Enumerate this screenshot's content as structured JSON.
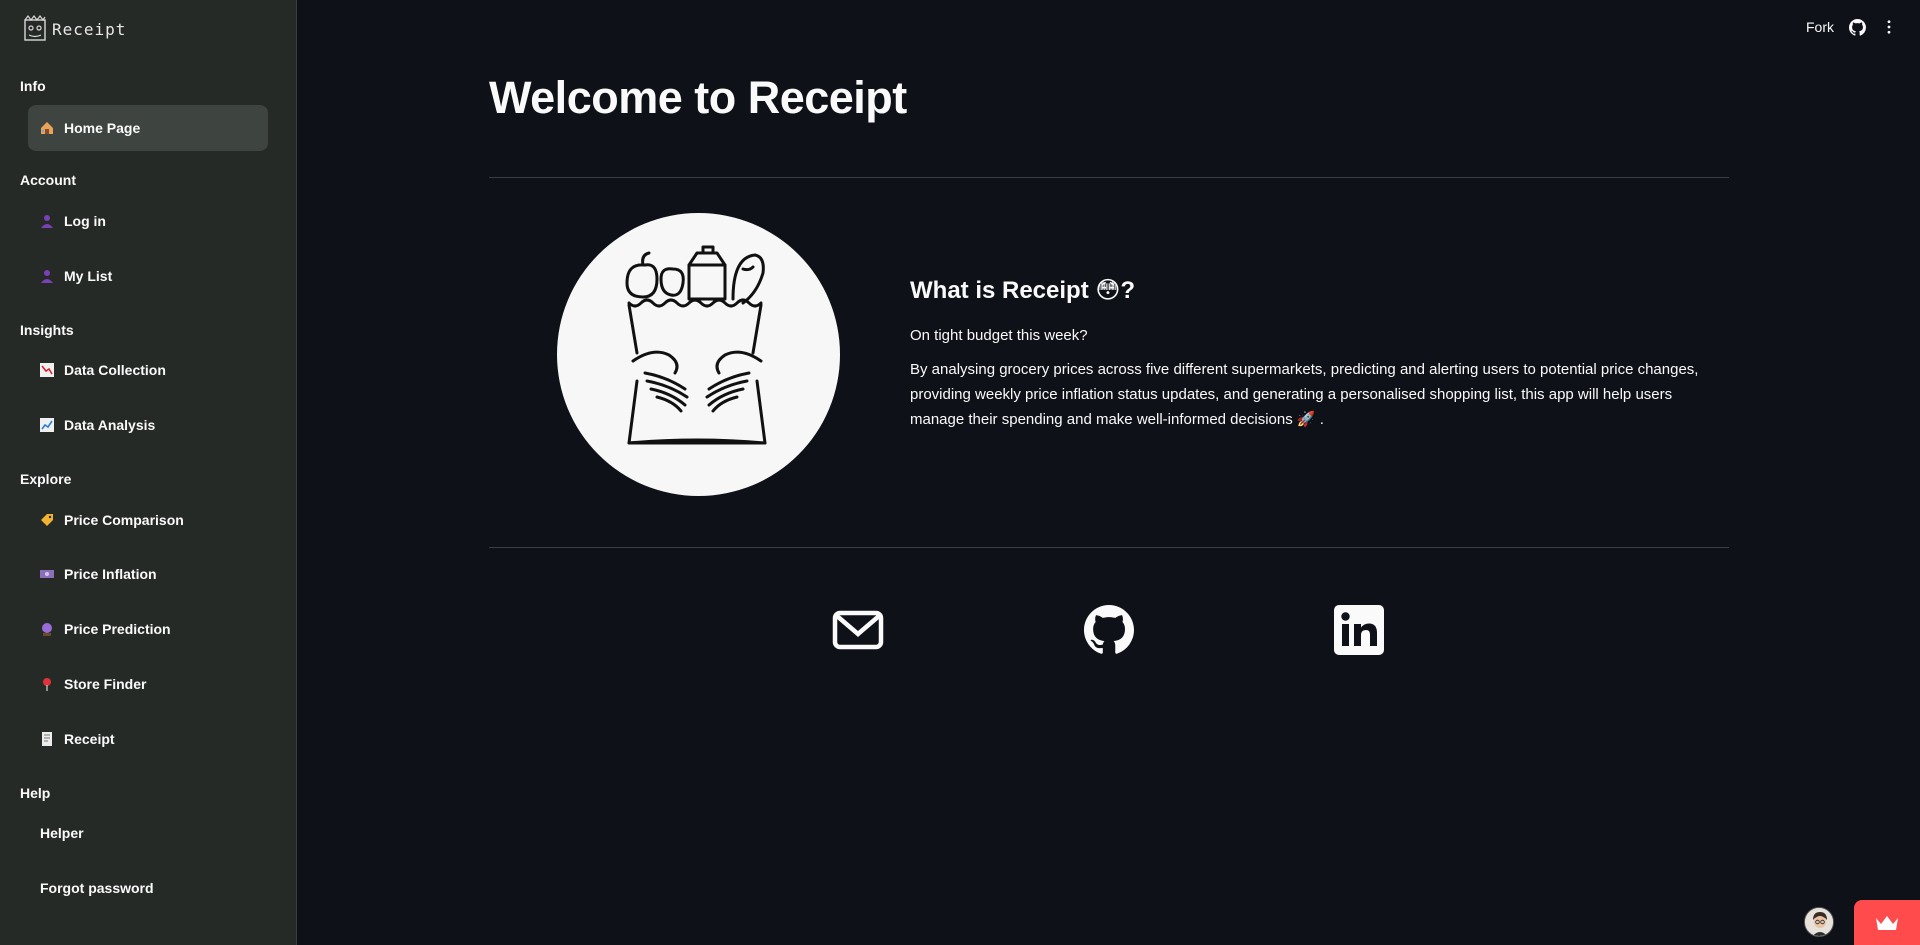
{
  "brand": {
    "name": "Receipt"
  },
  "sidebar": {
    "sections": [
      {
        "title": "Info",
        "items": [
          {
            "label": "Home Page",
            "icon": "house-icon"
          }
        ]
      },
      {
        "title": "Account",
        "items": [
          {
            "label": "Log in",
            "icon": "person-icon"
          },
          {
            "label": "My List",
            "icon": "person-icon"
          }
        ]
      },
      {
        "title": "Insights",
        "items": [
          {
            "label": "Data Collection",
            "icon": "chart-decreasing-icon"
          },
          {
            "label": "Data Analysis",
            "icon": "chart-increasing-icon"
          }
        ]
      },
      {
        "title": "Explore",
        "items": [
          {
            "label": "Price Comparison",
            "icon": "label-tag-icon"
          },
          {
            "label": "Price Inflation",
            "icon": "money-icon"
          },
          {
            "label": "Price Prediction",
            "icon": "crystal-ball-icon"
          },
          {
            "label": "Store Finder",
            "icon": "pin-icon"
          },
          {
            "label": "Receipt",
            "icon": "receipt-icon"
          }
        ]
      },
      {
        "title": "Help",
        "items": [
          {
            "label": "Helper"
          },
          {
            "label": "Forgot password"
          }
        ]
      }
    ]
  },
  "topbar": {
    "fork_label": "Fork"
  },
  "main": {
    "title": "Welcome to Receipt",
    "about_heading_prefix": "What is Receipt ",
    "about_heading_emoji": "😳",
    "about_heading_suffix": "?",
    "tagline": "On tight budget this week?",
    "description": "By analysing grocery prices across five different supermarkets, predicting and alerting users to potential price changes, providing weekly price inflation status updates, and generating a personalised shopping list, this app will help users manage their spending and make well-informed decisions",
    "description_end_emoji": "🚀",
    "description_end": " ."
  },
  "social": [
    "mail-icon",
    "github-icon",
    "linkedin-icon"
  ],
  "colors": {
    "sidebar_bg": "#262a27",
    "main_bg": "#0e1117",
    "active_item_bg": "#3e4440",
    "accent": "#ff4b4b"
  }
}
